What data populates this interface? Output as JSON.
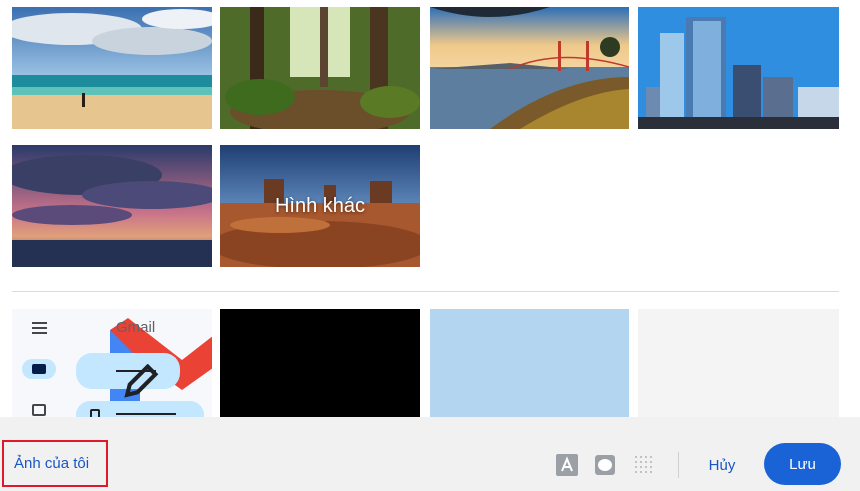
{
  "themes": {
    "tiles": [
      {
        "name": "beach"
      },
      {
        "name": "forest"
      },
      {
        "name": "golden-gate-bridge"
      },
      {
        "name": "city-skyline"
      },
      {
        "name": "stormy-sunset"
      }
    ],
    "more_label": "Hình khác",
    "gmail_preview": {
      "brand": "Gmail"
    },
    "solid_colors": [
      "#000000",
      "#b3d5f0",
      "#f4f4f4"
    ]
  },
  "footer": {
    "my_photos_label": "Ảnh của tôi",
    "tools": [
      {
        "icon": "text-background-icon"
      },
      {
        "icon": "border-icon"
      },
      {
        "icon": "vignette-icon"
      }
    ],
    "cancel_label": "Hủy",
    "save_label": "Lưu",
    "accent_color": "#1a63d6",
    "highlight_color": "#e0182c"
  }
}
